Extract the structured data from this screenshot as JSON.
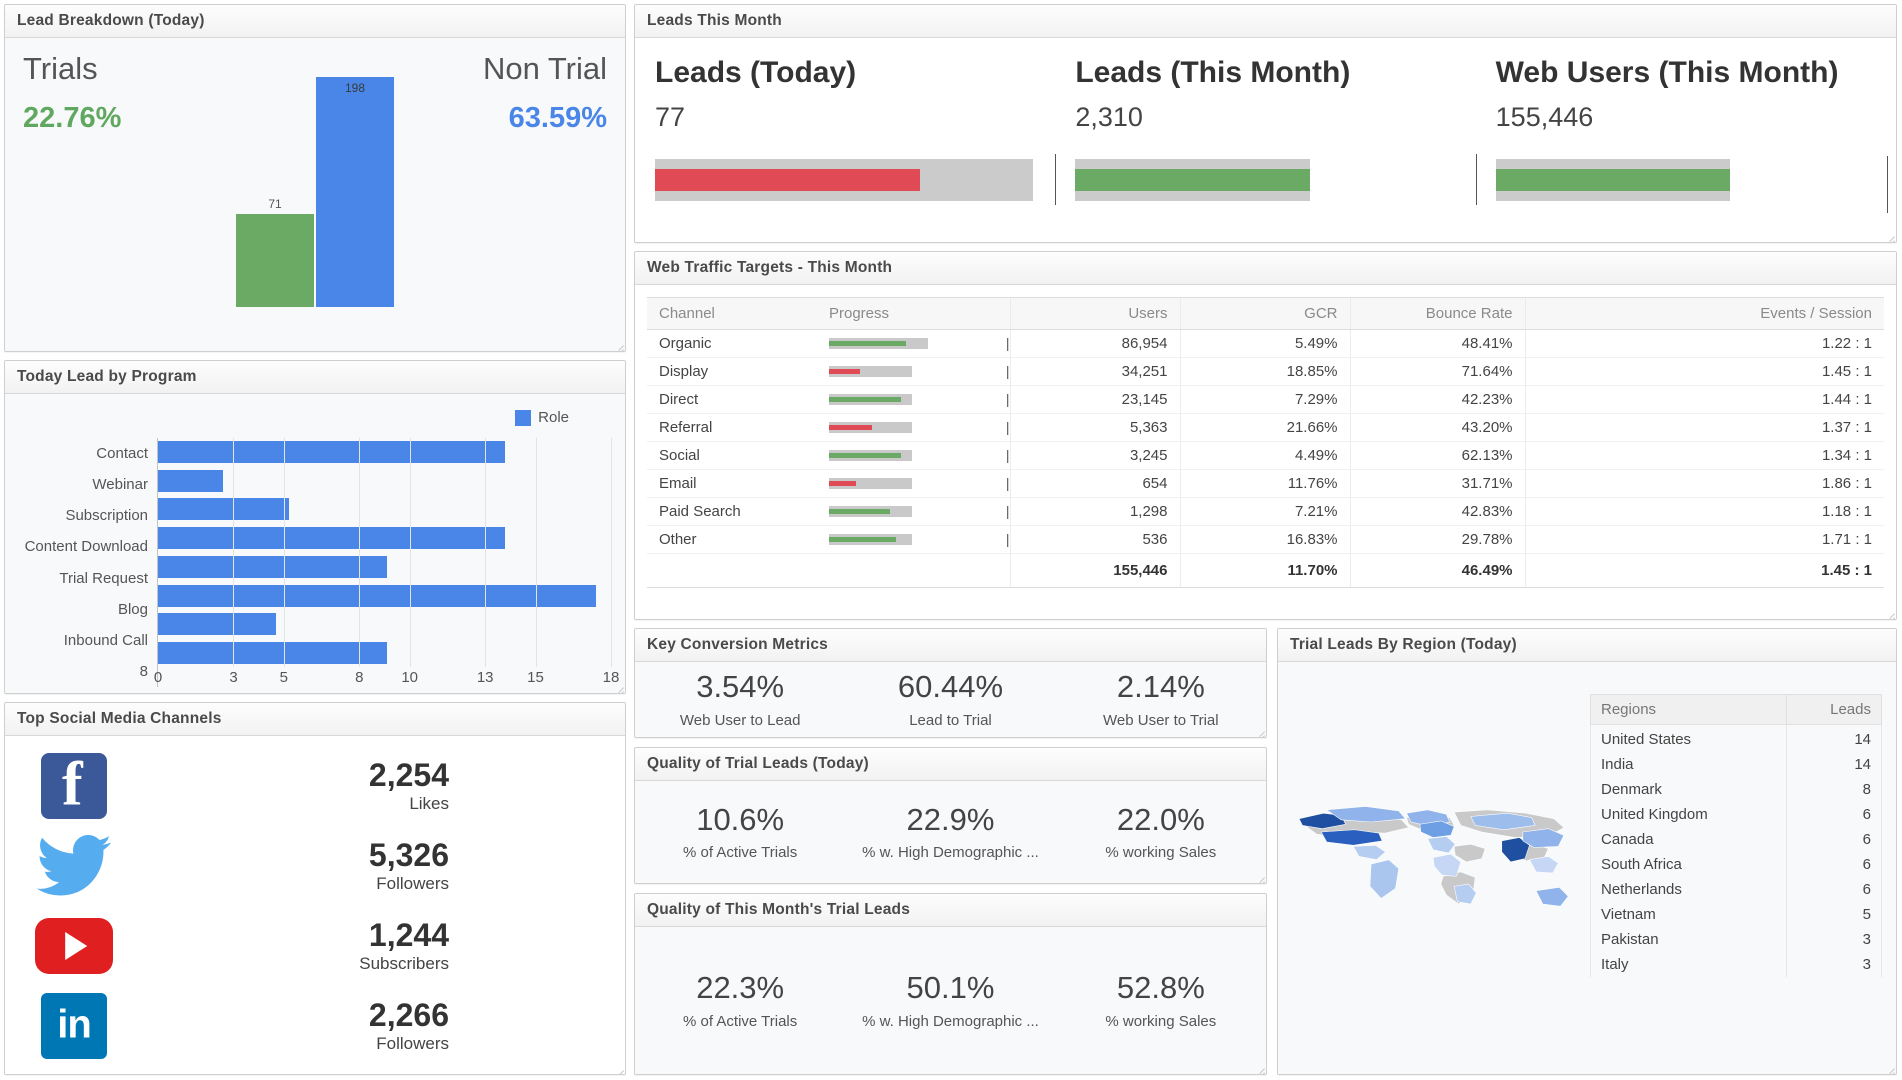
{
  "lead_breakdown": {
    "title": "Lead Breakdown (Today)",
    "left_label": "Trials",
    "left_pct": "22.76%",
    "right_label": "Non Trial",
    "right_pct": "63.59%",
    "bar_green_label": "71",
    "bar_blue_label": "198",
    "colors": {
      "green": "#6aaa64",
      "blue": "#4a86e8"
    }
  },
  "today_program": {
    "title": "Today Lead by Program",
    "legend_label": "Role"
  },
  "social": {
    "title": "Top Social Media Channels",
    "rows": [
      {
        "icon": "facebook-icon",
        "value": "2,254",
        "caption": "Likes"
      },
      {
        "icon": "twitter-icon",
        "value": "5,326",
        "caption": "Followers"
      },
      {
        "icon": "youtube-icon",
        "value": "1,244",
        "caption": "Subscribers"
      },
      {
        "icon": "linkedin-icon",
        "value": "2,266",
        "caption": "Followers"
      }
    ]
  },
  "leads_month": {
    "title": "Leads This Month",
    "kpis": [
      {
        "title": "Leads (Today)",
        "value": "77",
        "bar_color": "red",
        "range_pct": 100,
        "measure_pct": 70
      },
      {
        "title": "Leads (This Month)",
        "value": "2,310",
        "bar_color": "green",
        "range_pct": 62,
        "measure_pct": 100
      },
      {
        "title": "Web Users (This Month)",
        "value": "155,446",
        "bar_color": "green",
        "range_pct": 62,
        "measure_pct": 100
      }
    ]
  },
  "traffic": {
    "title": "Web Traffic Targets - This Month",
    "columns": [
      "Channel",
      "Progress",
      "",
      "Users",
      "GCR",
      "Bounce Rate",
      "Events / Session"
    ],
    "rows": [
      {
        "channel": "Organic",
        "users": "86,954",
        "gcr": "5.49%",
        "bounce": "48.41%",
        "events": "1.22 : 1",
        "range_pct": 62,
        "measure_pct": 78,
        "measure_color": "green"
      },
      {
        "channel": "Display",
        "users": "34,251",
        "gcr": "18.85%",
        "bounce": "71.64%",
        "events": "1.45 : 1",
        "range_pct": 52,
        "measure_pct": 37,
        "measure_color": "red"
      },
      {
        "channel": "Direct",
        "users": "23,145",
        "gcr": "7.29%",
        "bounce": "42.23%",
        "events": "1.44 : 1",
        "range_pct": 52,
        "measure_pct": 86,
        "measure_color": "green"
      },
      {
        "channel": "Referral",
        "users": "5,363",
        "gcr": "21.66%",
        "bounce": "43.20%",
        "events": "1.37 : 1",
        "range_pct": 52,
        "measure_pct": 52,
        "measure_color": "red"
      },
      {
        "channel": "Social",
        "users": "3,245",
        "gcr": "4.49%",
        "bounce": "62.13%",
        "events": "1.34 : 1",
        "range_pct": 52,
        "measure_pct": 86,
        "measure_color": "green"
      },
      {
        "channel": "Email",
        "users": "654",
        "gcr": "11.76%",
        "bounce": "31.71%",
        "events": "1.86 : 1",
        "range_pct": 52,
        "measure_pct": 33,
        "measure_color": "red"
      },
      {
        "channel": "Paid Search",
        "users": "1,298",
        "gcr": "7.21%",
        "bounce": "42.83%",
        "events": "1.18 : 1",
        "range_pct": 52,
        "measure_pct": 73,
        "measure_color": "green"
      },
      {
        "channel": "Other",
        "users": "536",
        "gcr": "16.83%",
        "bounce": "29.78%",
        "events": "1.71 : 1",
        "range_pct": 52,
        "measure_pct": 80,
        "measure_color": "green"
      }
    ],
    "total": {
      "channel": "",
      "users": "155,446",
      "gcr": "11.70%",
      "bounce": "46.49%",
      "events": "1.45 : 1"
    }
  },
  "key_conversion": {
    "title": "Key Conversion Metrics",
    "metrics": [
      {
        "value": "3.54%",
        "caption": "Web User to Lead"
      },
      {
        "value": "60.44%",
        "caption": "Lead to Trial"
      },
      {
        "value": "2.14%",
        "caption": "Web User to Trial"
      }
    ]
  },
  "quality_today": {
    "title": "Quality of Trial Leads (Today)",
    "metrics": [
      {
        "value": "10.6%",
        "caption": "% of Active Trials"
      },
      {
        "value": "22.9%",
        "caption": "% w. High Demographic ..."
      },
      {
        "value": "22.0%",
        "caption": "% working Sales"
      }
    ]
  },
  "quality_month": {
    "title": "Quality of This Month's Trial Leads",
    "metrics": [
      {
        "value": "22.3%",
        "caption": "% of Active Trials"
      },
      {
        "value": "50.1%",
        "caption": "% w. High Demographic ..."
      },
      {
        "value": "52.8%",
        "caption": "% working Sales"
      }
    ]
  },
  "region": {
    "title": "Trial Leads By Region (Today)",
    "columns": [
      "Regions",
      "Leads"
    ],
    "rows": [
      {
        "region": "United States",
        "leads": "14"
      },
      {
        "region": "India",
        "leads": "14"
      },
      {
        "region": "Denmark",
        "leads": "8"
      },
      {
        "region": "United Kingdom",
        "leads": "6"
      },
      {
        "region": "Canada",
        "leads": "6"
      },
      {
        "region": "South Africa",
        "leads": "6"
      },
      {
        "region": "Netherlands",
        "leads": "6"
      },
      {
        "region": "Vietnam",
        "leads": "5"
      },
      {
        "region": "Pakistan",
        "leads": "3"
      },
      {
        "region": "Italy",
        "leads": "3"
      }
    ]
  },
  "chart_data": [
    {
      "type": "bar",
      "title": "Lead Breakdown (Today)",
      "categories": [
        "Trials",
        "Non Trial"
      ],
      "values": [
        71,
        198
      ],
      "value_labels": [
        "71",
        "198"
      ],
      "percentages": [
        "22.76%",
        "63.59%"
      ],
      "colors": [
        "#6aaa64",
        "#4a86e8"
      ],
      "xlabel": "",
      "ylabel": "",
      "ylim": [
        0,
        210
      ],
      "grid": false,
      "legend": "none"
    },
    {
      "type": "bar",
      "title": "Today Lead by Program",
      "orientation": "horizontal",
      "categories": [
        "Contact",
        "Webinar",
        "Subscription",
        "Content Download",
        "Trial Request",
        "Blog",
        "Inbound Call",
        "8"
      ],
      "values": [
        13.8,
        2.6,
        5.2,
        13.8,
        9.1,
        17.4,
        4.7,
        9.1
      ],
      "series": [
        {
          "name": "Role",
          "values": [
            13.8,
            2.6,
            5.2,
            13.8,
            9.1,
            17.4,
            4.7,
            9.1
          ]
        }
      ],
      "xticks": [
        "0",
        "3",
        "5",
        "8",
        "10",
        "13",
        "15",
        "18"
      ],
      "xlim": [
        0,
        18
      ],
      "grid": true,
      "legend": "top-right",
      "legend_entries": [
        "Role"
      ],
      "color": "#4a86e8",
      "xlabel": "",
      "ylabel": ""
    },
    {
      "type": "bar",
      "title": "Leads This Month",
      "subtype": "bullet",
      "categories": [
        "Leads (Today)",
        "Leads (This Month)",
        "Web Users (This Month)"
      ],
      "values": [
        77,
        2310,
        155446
      ],
      "value_labels": [
        "77",
        "2,310",
        "155,446"
      ],
      "status_colors": [
        "#e04a54",
        "#6aaa64",
        "#6aaa64"
      ]
    },
    {
      "type": "table",
      "title": "Web Traffic Targets - This Month",
      "columns": [
        "Channel",
        "Progress",
        "Users",
        "GCR",
        "Bounce Rate",
        "Events / Session"
      ],
      "rows": [
        [
          "Organic",
          "",
          "86,954",
          "5.49%",
          "48.41%",
          "1.22 : 1"
        ],
        [
          "Display",
          "",
          "34,251",
          "18.85%",
          "71.64%",
          "1.45 : 1"
        ],
        [
          "Direct",
          "",
          "23,145",
          "7.29%",
          "42.23%",
          "1.44 : 1"
        ],
        [
          "Referral",
          "",
          "5,363",
          "21.66%",
          "43.20%",
          "1.37 : 1"
        ],
        [
          "Social",
          "",
          "3,245",
          "4.49%",
          "62.13%",
          "1.34 : 1"
        ],
        [
          "Email",
          "",
          "654",
          "11.76%",
          "31.71%",
          "1.86 : 1"
        ],
        [
          "Paid Search",
          "",
          "1,298",
          "7.21%",
          "42.83%",
          "1.18 : 1"
        ],
        [
          "Other",
          "",
          "536",
          "16.83%",
          "29.78%",
          "1.71 : 1"
        ],
        [
          "",
          "",
          "155,446",
          "11.70%",
          "46.49%",
          "1.45 : 1"
        ]
      ]
    },
    {
      "type": "heatmap",
      "subtype": "choropleth",
      "title": "Trial Leads By Region (Today)",
      "categories": [
        "United States",
        "India",
        "Denmark",
        "United Kingdom",
        "Canada",
        "South Africa",
        "Netherlands",
        "Vietnam",
        "Pakistan",
        "Italy"
      ],
      "values": [
        14,
        14,
        8,
        6,
        6,
        6,
        6,
        5,
        3,
        3
      ],
      "legend": "none"
    }
  ]
}
